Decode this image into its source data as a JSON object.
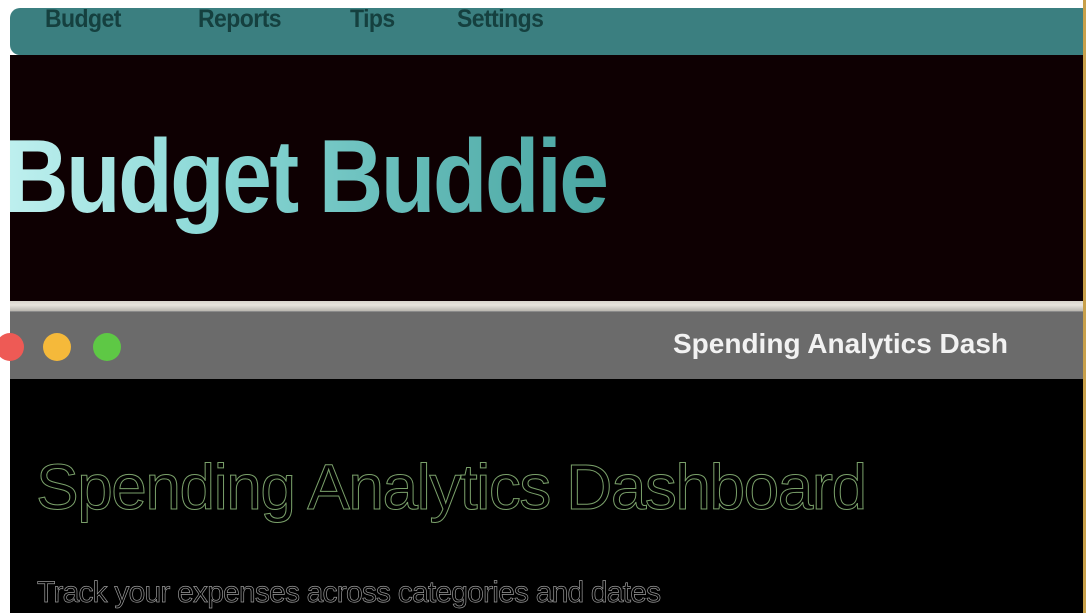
{
  "nav": {
    "items": [
      {
        "label": "Budget"
      },
      {
        "label": "Reports"
      },
      {
        "label": "Tips"
      },
      {
        "label": "Settings"
      }
    ]
  },
  "hero": {
    "title": "Budget Buddie"
  },
  "window": {
    "title": "Spending Analytics Dash"
  },
  "dashboard": {
    "title": "Spending Analytics Dashboard",
    "subtitle": "Track your expenses across categories and dates"
  },
  "colors": {
    "nav_background": "#3b7f80",
    "hero_background": "#0e0002",
    "title_gradient_start": "#bff0ef",
    "title_gradient_end": "#4aa6a2",
    "titlebar": "#6b6b6b",
    "close": "#ee5a55",
    "minimize": "#f5b93a",
    "maximize": "#5ec845",
    "dashboard_title_stroke": "#7aa06a"
  }
}
